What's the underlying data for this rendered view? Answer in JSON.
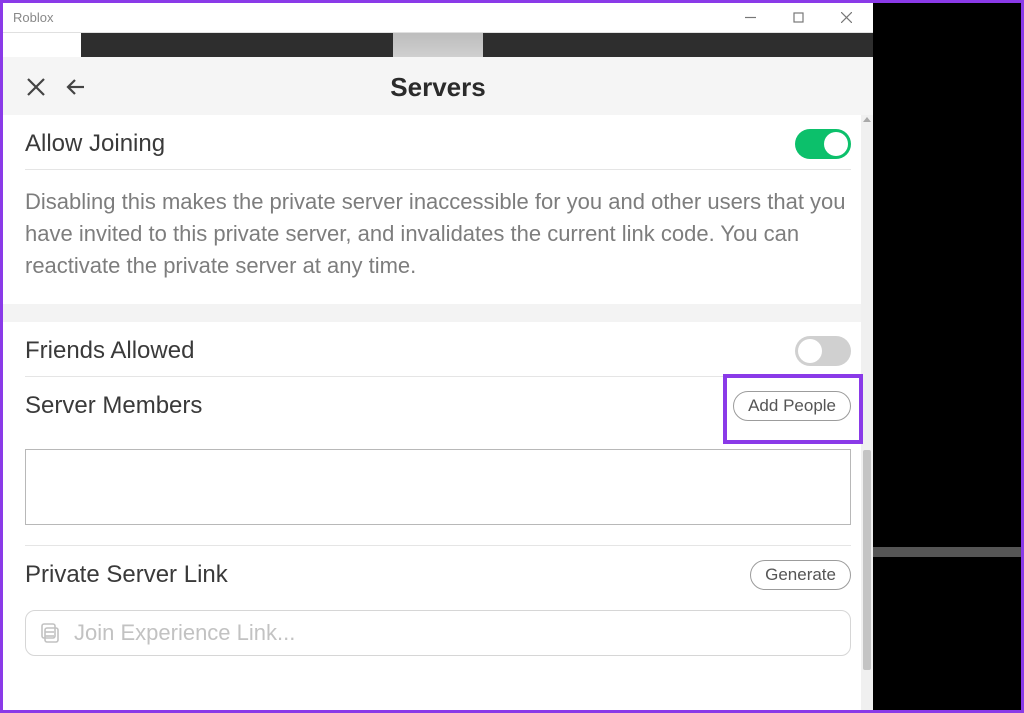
{
  "window": {
    "title": "Roblox"
  },
  "header": {
    "title": "Servers"
  },
  "allow_joining": {
    "label": "Allow Joining",
    "enabled": true,
    "description": "Disabling this makes the private server inaccessible for you and other users that you have invited to this private server, and invalidates the current link code. You can reactivate the private server at any time."
  },
  "friends_allowed": {
    "label": "Friends Allowed",
    "enabled": false
  },
  "server_members": {
    "label": "Server Members",
    "add_button": "Add People"
  },
  "private_link": {
    "label": "Private Server Link",
    "generate_button": "Generate",
    "placeholder": "Join Experience Link..."
  }
}
